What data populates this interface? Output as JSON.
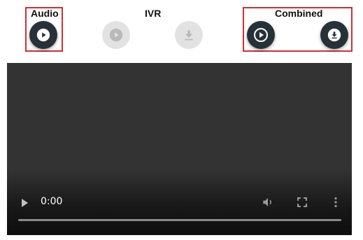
{
  "audio": {
    "label": "Audio"
  },
  "ivr": {
    "label": "IVR"
  },
  "combined": {
    "label": "Combined"
  },
  "player": {
    "current_time": "0:00"
  }
}
